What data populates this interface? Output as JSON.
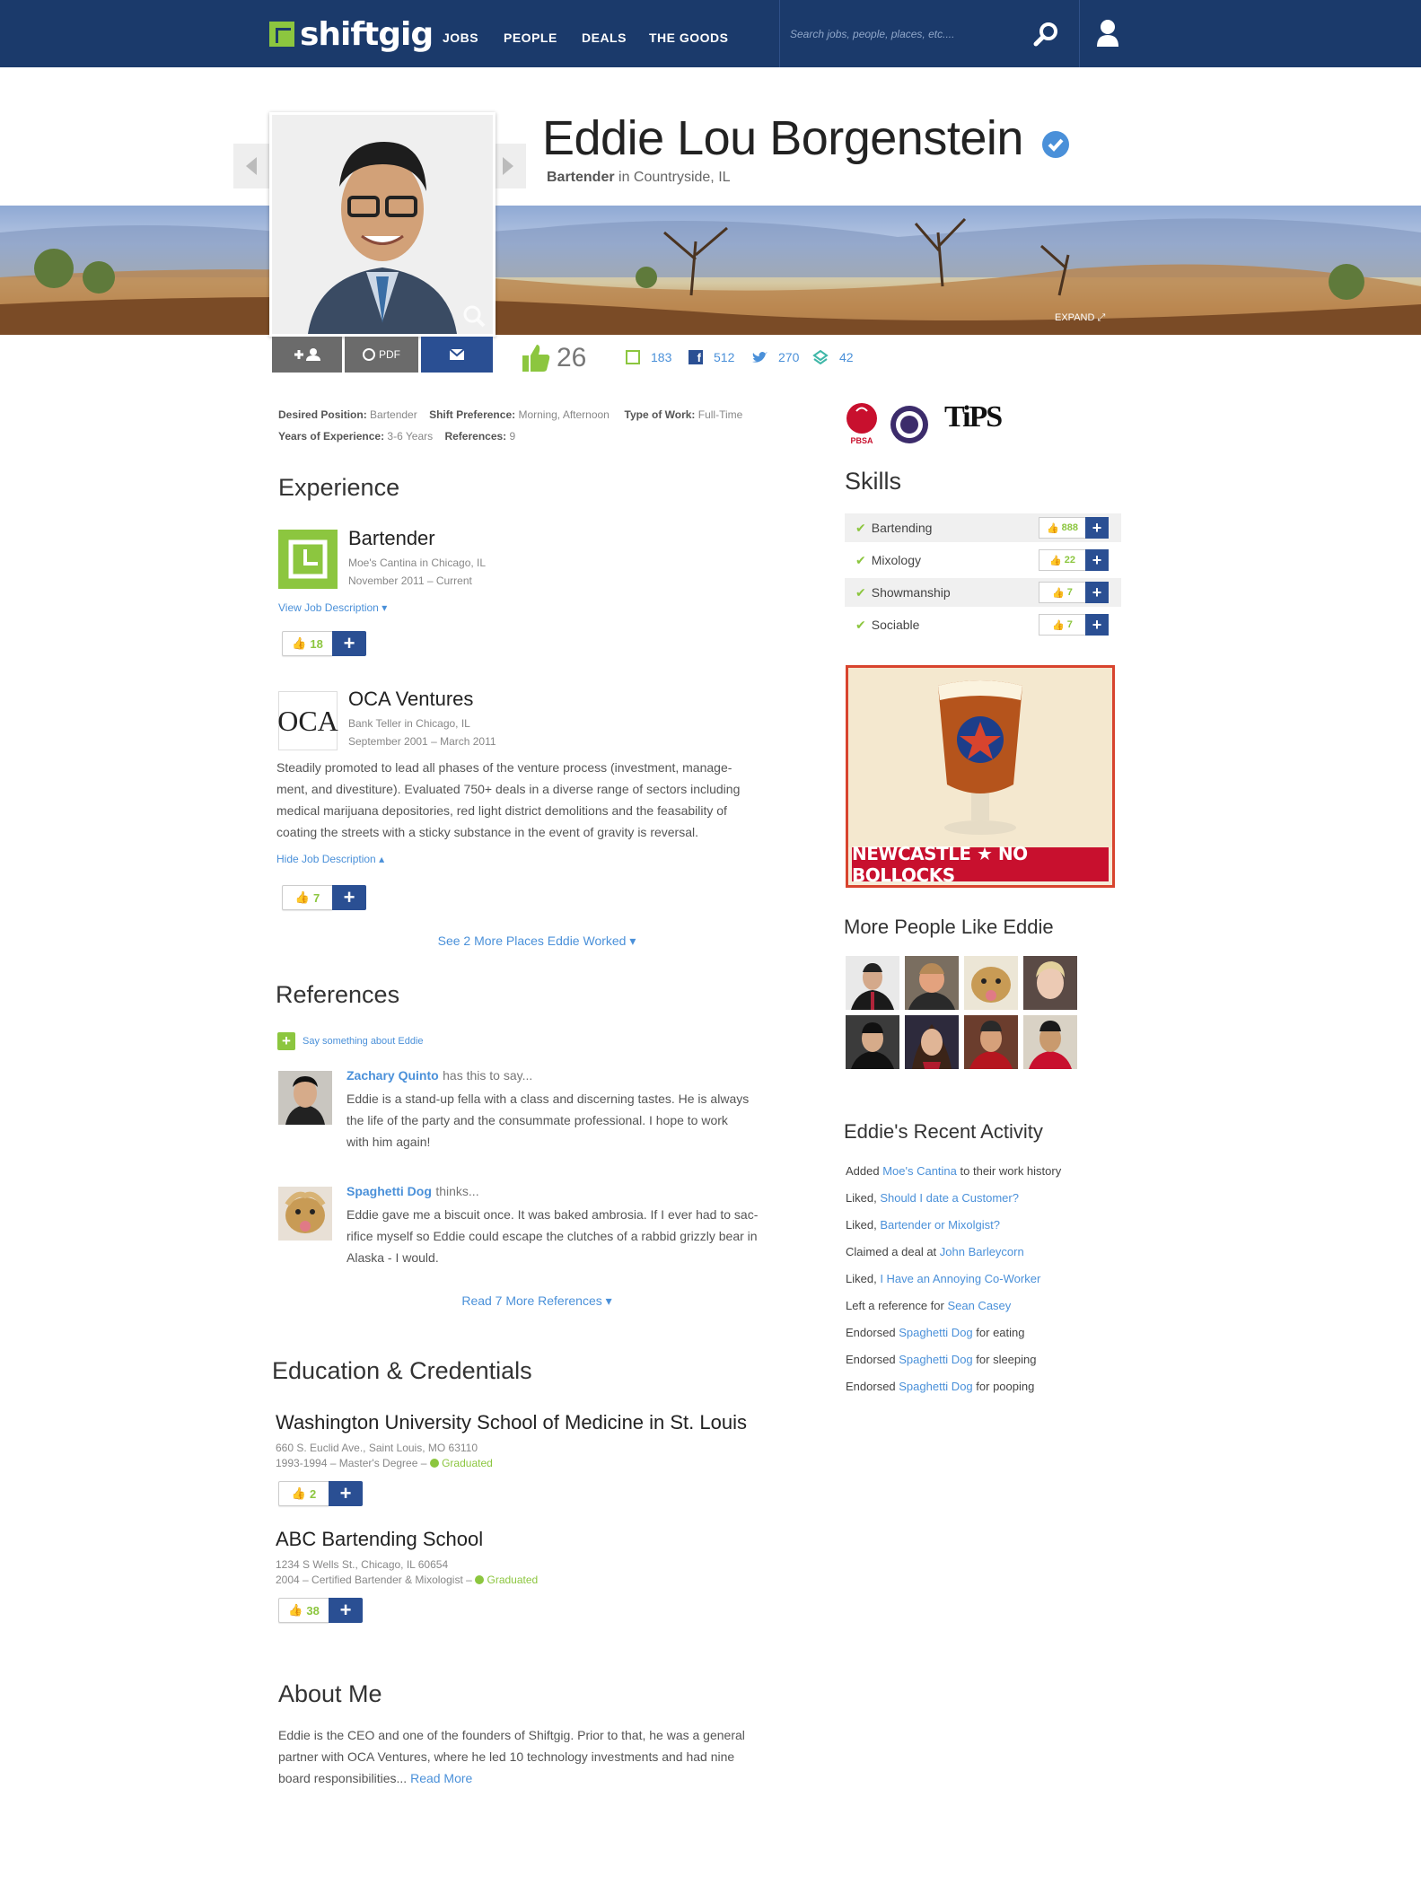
{
  "header": {
    "logo_text": "shiftgig",
    "nav": [
      "JOBS",
      "PEOPLE",
      "DEALS",
      "THE GOODS"
    ],
    "search_placeholder": "Search jobs, people, places, etc....",
    "colors": {
      "navy": "#1b3a6b",
      "green": "#8cc63f",
      "link": "#4a90d9",
      "button_blue": "#2a4f93",
      "button_gray": "#6b6b6b"
    }
  },
  "profile": {
    "name": "Eddie Lou Borgenstein",
    "verified_icon": "check-badge-icon",
    "title": "Bartender",
    "location_text": "in Countryside, IL",
    "expand_label": "EXPAND",
    "actions": {
      "add_label": "+",
      "pdf_label": "PDF",
      "email_icon": "envelope-icon"
    },
    "likes": "26",
    "stats": [
      {
        "icon": "shiftgig-icon",
        "value": "183"
      },
      {
        "icon": "facebook-icon",
        "value": "512"
      },
      {
        "icon": "twitter-icon",
        "value": "270"
      },
      {
        "icon": "foursquare-icon",
        "value": "42"
      }
    ]
  },
  "details": {
    "desired_position_label": "Desired Position:",
    "desired_position": "Bartender",
    "shift_pref_label": "Shift Preference:",
    "shift_pref": "Morning, Afternoon",
    "work_type_label": "Type of Work:",
    "work_type": "Full-Time",
    "experience_label": "Years of Experience:",
    "experience": "3-6 Years",
    "references_label": "References:",
    "references": "9"
  },
  "experience": {
    "heading": "Experience",
    "jobs": [
      {
        "title": "Bartender",
        "place": "Moe's Cantina in Chicago, IL",
        "dates": "November 2011 – Current",
        "toggle": "View Job Description",
        "endorse": "18"
      },
      {
        "logo_text": "OCA",
        "title": "OCA Ventures",
        "place": "Bank Teller in Chicago, IL",
        "dates": "September 2001 – March 2011",
        "description": [
          "Steadily promoted to lead all phases of the venture process (investment, manage-",
          "ment, and divestiture). Evaluated 750+ deals in a diverse range of sectors including",
          "medical marijuana depositories, red light district demolitions and the feasability of",
          "coating the streets with a sticky substance in the event of gravity is reversal."
        ],
        "toggle": "Hide Job Description",
        "endorse": "7"
      }
    ],
    "see_more": "See 2 More Places Eddie Worked"
  },
  "references": {
    "heading": "References",
    "add_label": "Say something about Eddie",
    "items": [
      {
        "name": "Zachary Quinto",
        "verb": "has this to say...",
        "lines": [
          "Eddie is a stand-up fella with a class and discerning tastes. He is always",
          "the life of the party and the consummate professional. I hope to work",
          "with him again!"
        ]
      },
      {
        "name": "Spaghetti Dog",
        "verb": "thinks...",
        "lines": [
          "Eddie gave me a biscuit once. It was baked ambrosia. If I ever had to sac-",
          "rifice myself so Eddie could escape the clutches of a rabbid grizzly bear in",
          "Alaska - I would."
        ]
      }
    ],
    "read_more": "Read 7 More References"
  },
  "education": {
    "heading": "Education & Credentials",
    "items": [
      {
        "school": "Washington University School of Medicine in St. Louis",
        "address": "660 S. Euclid Ave., Saint Louis, MO 63110",
        "detail": "1993-1994 – Master's Degree –",
        "status": "Graduated",
        "endorse": "2"
      },
      {
        "school": "ABC Bartending School",
        "address": "1234 S Wells St., Chicago, IL 60654",
        "detail": "2004 – Certified Bartender & Mixologist –",
        "status": "Graduated",
        "endorse": "38"
      }
    ]
  },
  "about": {
    "heading": "About Me",
    "lines": [
      "Eddie is the CEO and one of the founders of Shiftgig. Prior to that, he was a general",
      "partner with OCA Ventures, where he led 10 technology investments and had nine",
      "board responsibilities..."
    ],
    "read_more": "Read More"
  },
  "sidebar": {
    "badges": [
      {
        "label": "PBSA"
      },
      {
        "label": "seal"
      },
      {
        "label": "TiPS"
      }
    ],
    "skills_heading": "Skills",
    "skills": [
      {
        "name": "Bartending",
        "count": "888"
      },
      {
        "name": "Mixology",
        "count": "22"
      },
      {
        "name": "Showmanship",
        "count": "7"
      },
      {
        "name": "Sociable",
        "count": "7"
      }
    ],
    "ad_text": "NEWCASTLE ★ NO BOLLOCKS",
    "people_heading": "More People Like Eddie",
    "activity_heading": "Eddie's Recent Activity",
    "activity": [
      {
        "pre": "Added ",
        "link": "Moe's Cantina",
        "post": " to their work history"
      },
      {
        "pre": "Liked, ",
        "link": "Should I date a Customer?",
        "post": ""
      },
      {
        "pre": "Liked,  ",
        "link": "Bartender or Mixolgist?",
        "post": ""
      },
      {
        "pre": "Claimed a deal at ",
        "link": "John Barleycorn",
        "post": ""
      },
      {
        "pre": "Liked,  ",
        "link": "I Have an Annoying Co-Worker",
        "post": ""
      },
      {
        "pre": "Left a reference for ",
        "link": "Sean Casey",
        "post": ""
      },
      {
        "pre": "Endorsed ",
        "link": "Spaghetti Dog",
        "post": " for eating"
      },
      {
        "pre": "Endorsed ",
        "link": "Spaghetti Dog",
        "post": " for sleeping"
      },
      {
        "pre": "Endorsed ",
        "link": "Spaghetti Dog",
        "post": " for pooping"
      }
    ]
  }
}
